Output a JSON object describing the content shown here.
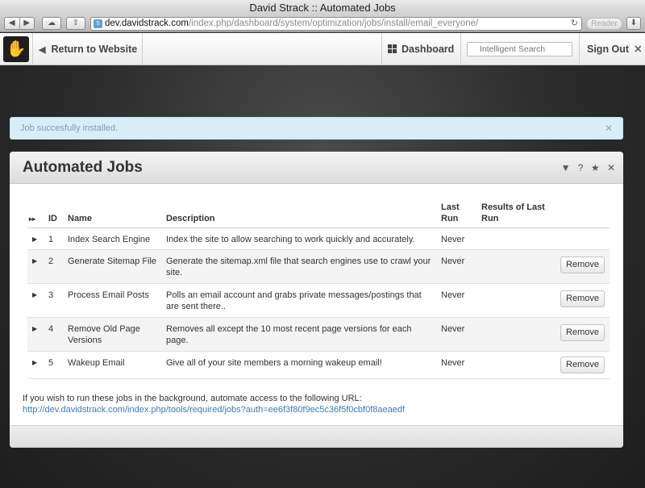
{
  "browser": {
    "window_title": "David Strack :: Automated Jobs",
    "url_host": "dev.davidstrack.com",
    "url_path": "/index.php/dashboard/system/optimization/jobs/install/email_everyone/",
    "reader_label": "Reader"
  },
  "topbar": {
    "return_label": "Return to Website",
    "dashboard_label": "Dashboard",
    "search_placeholder": "Intelligent Search",
    "signout_label": "Sign Out"
  },
  "alert": {
    "message": "Job succesfully installed."
  },
  "panel": {
    "title": "Automated Jobs",
    "columns": {
      "id": "ID",
      "name": "Name",
      "description": "Description",
      "last_run_1": "Last",
      "last_run_2": "Run",
      "results_1": "Results of Last",
      "results_2": "Run"
    },
    "rows": [
      {
        "id": "1",
        "name": "Index Search Engine",
        "description": "Index the site to allow searching to work quickly and accurately.",
        "last_run": "Never",
        "action": ""
      },
      {
        "id": "2",
        "name": "Generate Sitemap File",
        "description": "Generate the sitemap.xml file that search engines use to crawl your site.",
        "last_run": "Never",
        "action": "Remove"
      },
      {
        "id": "3",
        "name": "Process Email Posts",
        "description": "Polls an email account and grabs private messages/postings that are sent there..",
        "last_run": "Never",
        "action": "Remove"
      },
      {
        "id": "4",
        "name": "Remove Old Page Versions",
        "description": "Removes all except the 10 most recent page versions for each page.",
        "last_run": "Never",
        "action": "Remove"
      },
      {
        "id": "5",
        "name": "Wakeup Email",
        "description": "Give all of your site members a morning wakeup email!",
        "last_run": "Never",
        "action": "Remove"
      }
    ],
    "note": "If you wish to run these jobs in the background, automate access to the following URL:",
    "cron_url": "http://dev.davidstrack.com/index.php/tools/required/jobs?auth=ee6f3f80f9ec5c36f5f0cbf0f8aeaedf"
  }
}
